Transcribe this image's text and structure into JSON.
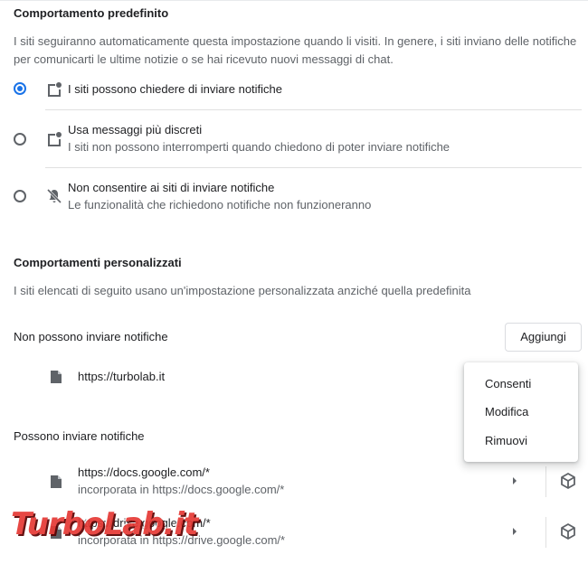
{
  "default_behavior": {
    "title": "Comportamento predefinito",
    "description": "I siti seguiranno automaticamente questa impostazione quando li visiti. In genere, i siti inviano delle notifiche per comunicarti le ultime notizie o se hai ricevuto nuovi messaggi di chat.",
    "options": [
      {
        "label": "I siti possono chiedere di inviare notifiche",
        "sublabel": "",
        "selected": true,
        "icon": "notification-icon"
      },
      {
        "label": "Usa messaggi più discreti",
        "sublabel": "I siti non possono interromperti quando chiedono di poter inviare notifiche",
        "selected": false,
        "icon": "notification-icon"
      },
      {
        "label": "Non consentire ai siti di inviare notifiche",
        "sublabel": "Le funzionalità che richiedono notifiche non funzioneranno",
        "selected": false,
        "icon": "notifications-off-icon"
      }
    ]
  },
  "custom_behavior": {
    "title": "Comportamenti personalizzati",
    "description": "I siti elencati di seguito usano un'impostazione personalizzata anziché quella predefinita",
    "blocked": {
      "heading": "Non possono inviare notifiche",
      "add_label": "Aggiungi",
      "sites": [
        {
          "url": "https://turbolab.it"
        }
      ]
    },
    "allowed": {
      "heading": "Possono inviare notifiche",
      "sites": [
        {
          "url": "https://docs.google.com/*",
          "embedded": "incorporata in https://docs.google.com/*"
        },
        {
          "url": "https://drive.google.com/*",
          "embedded": "incorporata in https://drive.google.com/*"
        }
      ]
    }
  },
  "context_menu": {
    "items": [
      "Consenti",
      "Modifica",
      "Rimuovi"
    ]
  },
  "watermark": "TurboLab.it",
  "colors": {
    "accent": "#1a73e8",
    "watermark": "#e53935"
  }
}
